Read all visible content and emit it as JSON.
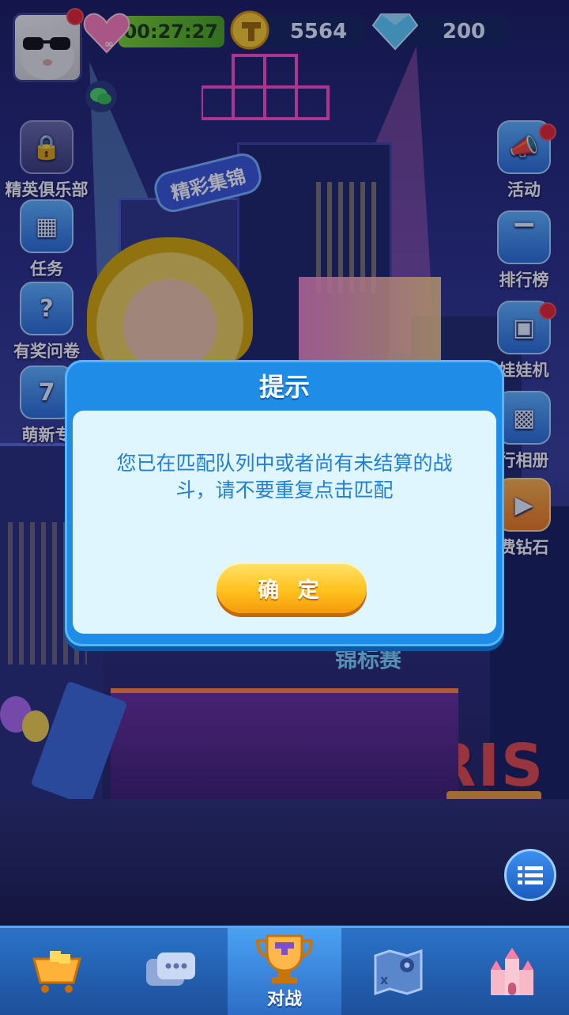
{
  "header": {
    "timer": "00:27:27",
    "coins": "5564",
    "diamonds": "200"
  },
  "left_menu": [
    {
      "label": "精英俱乐部",
      "icon": "lock-icon"
    },
    {
      "label": "任务",
      "icon": "task-board-icon"
    },
    {
      "label": "有奖问卷",
      "icon": "questionnaire-icon"
    },
    {
      "label": "萌新专",
      "icon": "calendar-7-icon"
    }
  ],
  "right_menu": [
    {
      "label": "活动",
      "icon": "megaphone-icon"
    },
    {
      "label": "排行榜",
      "icon": "podium-icon"
    },
    {
      "label": "娃娃机",
      "icon": "claw-machine-icon"
    },
    {
      "label": "行相册",
      "icon": "photo-album-icon"
    },
    {
      "label": "费钻石",
      "icon": "video-play-icon"
    }
  ],
  "scene": {
    "sign_text": "精彩集锦",
    "tetris_text": "TETRIS",
    "arena_text": "锦标赛"
  },
  "dialog": {
    "title": "提示",
    "message": "您已在匹配队列中或者尚有未结算的战斗，请不要重复点击匹配",
    "confirm": "确 定"
  },
  "bottom_nav": [
    {
      "label": "",
      "icon": "shop-cart-icon"
    },
    {
      "label": "",
      "icon": "chat-icon"
    },
    {
      "label": "对战",
      "icon": "trophy-icon"
    },
    {
      "label": "",
      "icon": "map-icon"
    },
    {
      "label": "",
      "icon": "castle-icon"
    }
  ],
  "colors": {
    "dialog_blue": "#1f8ce8",
    "dialog_body": "#dff6ff",
    "message_text": "#1f7fd9",
    "confirm_yellow": "#ffc21e",
    "nav_blue": "#2b73c9"
  }
}
